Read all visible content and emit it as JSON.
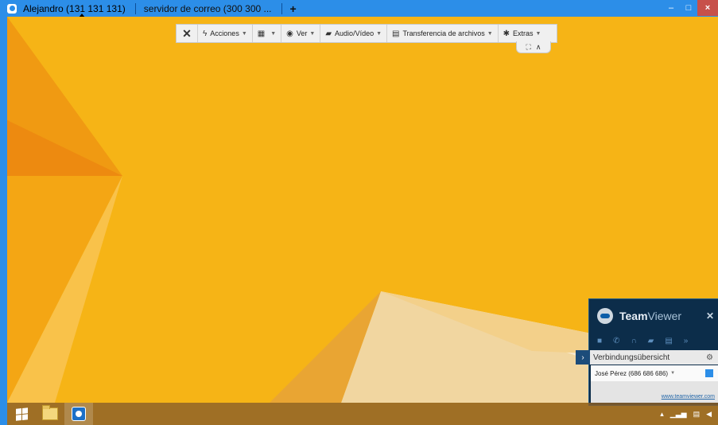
{
  "window": {
    "tabs": [
      {
        "label": "Alejandro (131 131 131)",
        "active": true
      },
      {
        "label": "servidor de correo (300 300 ...",
        "active": false
      }
    ],
    "new_tab_symbol": "+",
    "controls": {
      "minimize": "–",
      "maximize": "□",
      "close": "×"
    }
  },
  "toolbar": {
    "close_symbol": "✕",
    "items": [
      {
        "icon": "lightning-icon",
        "label": "Acciones"
      },
      {
        "icon": "grid-icon",
        "label": ""
      },
      {
        "icon": "eye-icon",
        "label": "Ver"
      },
      {
        "icon": "chat-icon",
        "label": "Audio/Vídeo"
      },
      {
        "icon": "files-icon",
        "label": "Transferencia de archivos"
      },
      {
        "icon": "extras-icon",
        "label": "Extras"
      }
    ]
  },
  "teamviewer_panel": {
    "brand_bold": "Team",
    "brand_light": "Viewer",
    "section_title": "Verbindungsübersicht",
    "connection": "José Pérez (686 686 686)",
    "footer_link": "www.teamviewer.com"
  },
  "colors": {
    "titlebar": "#2c8ee8",
    "desktop": "#f6b416",
    "teamviewer_panel": "#0c2d4a"
  }
}
